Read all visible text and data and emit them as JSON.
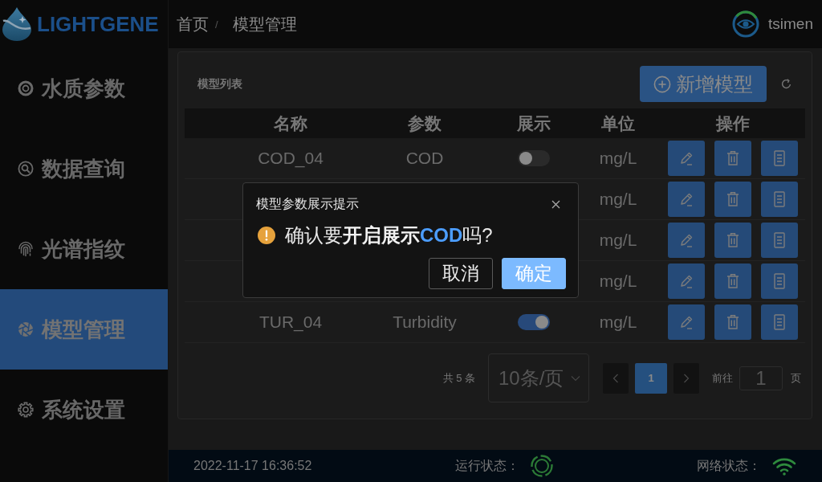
{
  "sidebar": {
    "logo": "LIGHTGENE",
    "items": [
      {
        "label": "水质参数",
        "selected": false
      },
      {
        "label": "数据查询",
        "selected": false
      },
      {
        "label": "光谱指纹",
        "selected": false
      },
      {
        "label": "模型管理",
        "selected": true
      },
      {
        "label": "系统设置",
        "selected": false
      }
    ]
  },
  "header": {
    "breadcrumb": [
      "首页",
      "模型管理"
    ],
    "breadcrumb_separator": "/",
    "user": "tsimen"
  },
  "card": {
    "title": "模型列表",
    "add_button": "新增模型"
  },
  "table": {
    "columns": [
      "名称",
      "参数",
      "展示",
      "单位",
      "操作"
    ],
    "rows": [
      {
        "name": "COD_04",
        "parameter": "COD",
        "on": false,
        "unit": "mg/L"
      },
      {
        "unit": "mg/L"
      },
      {
        "unit": "mg/L"
      },
      {
        "unit": "mg/L"
      },
      {
        "name": "TUR_04",
        "parameter": "Turbidity",
        "on": true,
        "unit": "mg/L"
      }
    ]
  },
  "pagination": {
    "total": "共 5 条",
    "page_size": "10条/页",
    "pages": [
      {
        "label": "1",
        "selected": true
      }
    ],
    "goto_label": "前往",
    "goto_value": "1",
    "goto_suffix": "页"
  },
  "dialog": {
    "title": "模型参数展示提示",
    "message": [
      {
        "text": "确认要",
        "kind": "text"
      },
      {
        "text": "开启展示",
        "kind": "emphasis"
      },
      {
        "text": "COD",
        "kind": "keyword"
      },
      {
        "text": "吗?",
        "kind": "text"
      }
    ],
    "buttons": [
      {
        "label": "取消",
        "kind": "secondary"
      },
      {
        "label": "确定",
        "kind": "primary"
      }
    ]
  },
  "status_bar": {
    "time": "2022-11-17 16:36:52",
    "run_status_label": "运行状态：",
    "network_status_label": "网络状态："
  }
}
